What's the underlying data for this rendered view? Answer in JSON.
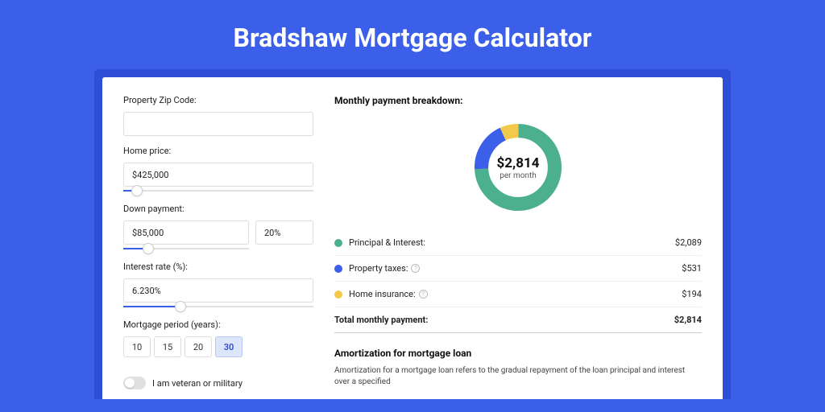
{
  "title": "Bradshaw Mortgage Calculator",
  "form": {
    "zip_label": "Property Zip Code:",
    "zip_value": "",
    "home_price_label": "Home price:",
    "home_price_value": "$425,000",
    "home_price_slider_pct": 7,
    "down_payment_label": "Down payment:",
    "down_payment_value": "$85,000",
    "down_payment_pct_value": "20%",
    "down_payment_slider_pct": 20,
    "interest_label": "Interest rate (%):",
    "interest_value": "6.230%",
    "interest_slider_pct": 30,
    "period_label": "Mortgage period (years):",
    "periods": [
      "10",
      "15",
      "20",
      "30"
    ],
    "period_active": "30",
    "veteran_label": "I am veteran or military"
  },
  "breakdown": {
    "title": "Monthly payment breakdown:",
    "center_amount": "$2,814",
    "center_sub": "per month",
    "rows": [
      {
        "label": "Principal & Interest:",
        "value": "$2,089",
        "color": "#4CAF8E",
        "info": false
      },
      {
        "label": "Property taxes:",
        "value": "$531",
        "color": "#3B5FE9",
        "info": true
      },
      {
        "label": "Home insurance:",
        "value": "$194",
        "color": "#F2C94C",
        "info": true
      }
    ],
    "total_label": "Total monthly payment:",
    "total_value": "$2,814"
  },
  "amort": {
    "title": "Amortization for mortgage loan",
    "text": "Amortization for a mortgage loan refers to the gradual repayment of the loan principal and interest over a specified"
  },
  "chart_data": {
    "type": "pie",
    "title": "Monthly payment breakdown",
    "series": [
      {
        "name": "Principal & Interest",
        "value": 2089,
        "color": "#4CAF8E"
      },
      {
        "name": "Property taxes",
        "value": 531,
        "color": "#3B5FE9"
      },
      {
        "name": "Home insurance",
        "value": 194,
        "color": "#F2C94C"
      }
    ],
    "total": 2814,
    "center_label": "$2,814 per month"
  }
}
